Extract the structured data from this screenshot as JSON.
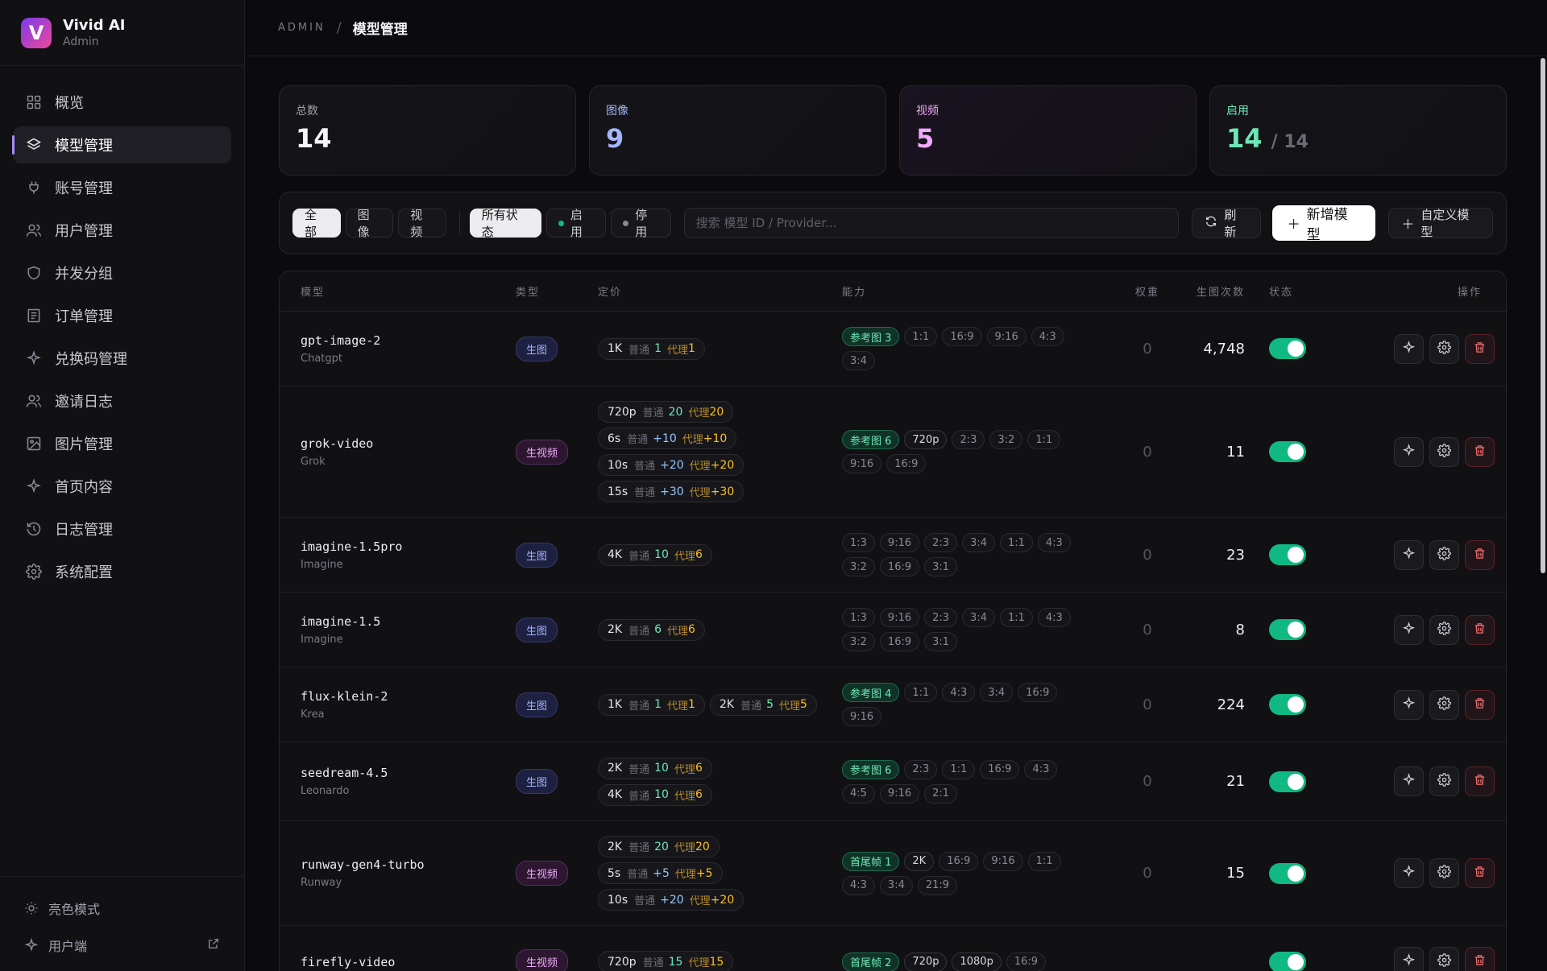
{
  "brand": {
    "name": "Vivid AI",
    "sub": "Admin",
    "logo_letter": "V"
  },
  "nav": [
    {
      "label": "概览",
      "icon": "grid-icon",
      "active": false
    },
    {
      "label": "模型管理",
      "icon": "layers-icon",
      "active": true
    },
    {
      "label": "账号管理",
      "icon": "plug-icon",
      "active": false
    },
    {
      "label": "用户管理",
      "icon": "users-icon",
      "active": false
    },
    {
      "label": "并发分组",
      "icon": "shield-icon",
      "active": false
    },
    {
      "label": "订单管理",
      "icon": "receipt-icon",
      "active": false
    },
    {
      "label": "兑换码管理",
      "icon": "sparkle-icon",
      "active": false
    },
    {
      "label": "邀请日志",
      "icon": "users-icon",
      "active": false
    },
    {
      "label": "图片管理",
      "icon": "image-icon",
      "active": false
    },
    {
      "label": "首页内容",
      "icon": "sparkle-icon",
      "active": false
    },
    {
      "label": "日志管理",
      "icon": "history-icon",
      "active": false
    },
    {
      "label": "系统配置",
      "icon": "gear-icon",
      "active": false
    }
  ],
  "footer": {
    "theme_label": "亮色模式",
    "client_label": "用户端"
  },
  "breadcrumb": {
    "root": "ADMIN",
    "sep": "/",
    "current": "模型管理"
  },
  "stats": {
    "total": {
      "label": "总数",
      "value": "14"
    },
    "image": {
      "label": "图像",
      "value": "9"
    },
    "video": {
      "label": "视频",
      "value": "5"
    },
    "enabled": {
      "label": "启用",
      "value": "14",
      "of": "/ 14"
    }
  },
  "filters": {
    "type": [
      "全部",
      "图像",
      "视频"
    ],
    "status": [
      "所有状态",
      "启用",
      "停用"
    ],
    "search_placeholder": "搜索 模型 ID / Provider...",
    "refresh_label": "刷新",
    "add_label": "新增模型",
    "custom_label": "自定义模型"
  },
  "table": {
    "headers": {
      "model": "模型",
      "type": "类型",
      "price": "定价",
      "cap": "能力",
      "weight": "权重",
      "count": "生图次数",
      "status": "状态",
      "ops": "操作"
    },
    "normal_label": "普通",
    "agent_label": "代理",
    "rows": [
      {
        "name": "gpt-image-2",
        "provider": "Chatgpt",
        "type": "生图",
        "kind": "img",
        "prices": [
          {
            "k": "1K",
            "n": "1",
            "a": "1"
          }
        ],
        "caps": [
          {
            "t": "参考图 3",
            "c": "ref"
          },
          {
            "t": "1:1"
          },
          {
            "t": "16:9"
          },
          {
            "t": "9:16"
          },
          {
            "t": "4:3"
          },
          {
            "t": "3:4"
          }
        ],
        "weight": "0",
        "count": "4,748",
        "enabled": true,
        "h": 93
      },
      {
        "name": "grok-video",
        "provider": "Grok",
        "type": "生视频",
        "kind": "vid",
        "prices": [
          {
            "k": "720p",
            "n": "20",
            "a": "20"
          },
          {
            "k": "6s",
            "n": "+10",
            "a": "+10",
            "plus": true
          },
          {
            "k": "10s",
            "n": "+20",
            "a": "+20",
            "plus": true
          },
          {
            "k": "15s",
            "n": "+30",
            "a": "+30",
            "plus": true
          }
        ],
        "caps": [
          {
            "t": "参考图 6",
            "c": "ref"
          },
          {
            "t": "720p",
            "c": "res"
          },
          {
            "t": "2:3"
          },
          {
            "t": "3:2"
          },
          {
            "t": "1:1"
          },
          {
            "t": "9:16"
          },
          {
            "t": "16:9"
          }
        ],
        "weight": "0",
        "count": "11",
        "enabled": true,
        "h": 163
      },
      {
        "name": "imagine-1.5pro",
        "provider": "Imagine",
        "type": "生图",
        "kind": "img",
        "prices": [
          {
            "k": "4K",
            "n": "10",
            "a": "6"
          }
        ],
        "caps": [
          {
            "t": "1:3"
          },
          {
            "t": "9:16"
          },
          {
            "t": "2:3"
          },
          {
            "t": "3:4"
          },
          {
            "t": "1:1"
          },
          {
            "t": "4:3"
          },
          {
            "t": "3:2"
          },
          {
            "t": "16:9"
          },
          {
            "t": "3:1"
          }
        ],
        "weight": "0",
        "count": "23",
        "enabled": true,
        "h": 93
      },
      {
        "name": "imagine-1.5",
        "provider": "Imagine",
        "type": "生图",
        "kind": "img",
        "prices": [
          {
            "k": "2K",
            "n": "6",
            "a": "6"
          }
        ],
        "caps": [
          {
            "t": "1:3"
          },
          {
            "t": "9:16"
          },
          {
            "t": "2:3"
          },
          {
            "t": "3:4"
          },
          {
            "t": "1:1"
          },
          {
            "t": "4:3"
          },
          {
            "t": "3:2"
          },
          {
            "t": "16:9"
          },
          {
            "t": "3:1"
          }
        ],
        "weight": "0",
        "count": "8",
        "enabled": true,
        "h": 93
      },
      {
        "name": "flux-klein-2",
        "provider": "Krea",
        "type": "生图",
        "kind": "img",
        "prices": [
          {
            "k": "1K",
            "n": "1",
            "a": "1"
          },
          {
            "k": "2K",
            "n": "5",
            "a": "5"
          }
        ],
        "caps": [
          {
            "t": "参考图 4",
            "c": "ref"
          },
          {
            "t": "1:1"
          },
          {
            "t": "4:3"
          },
          {
            "t": "3:4"
          },
          {
            "t": "16:9"
          },
          {
            "t": "9:16"
          }
        ],
        "weight": "0",
        "count": "224",
        "enabled": true,
        "h": 93
      },
      {
        "name": "seedream-4.5",
        "provider": "Leonardo",
        "type": "生图",
        "kind": "img",
        "prices": [
          {
            "k": "2K",
            "n": "10",
            "a": "6"
          },
          {
            "k": "4K",
            "n": "10",
            "a": "6"
          }
        ],
        "caps": [
          {
            "t": "参考图 6",
            "c": "ref"
          },
          {
            "t": "2:3"
          },
          {
            "t": "1:1"
          },
          {
            "t": "16:9"
          },
          {
            "t": "4:3"
          },
          {
            "t": "4:5"
          },
          {
            "t": "9:16"
          },
          {
            "t": "2:1"
          }
        ],
        "weight": "0",
        "count": "21",
        "enabled": true,
        "h": 98
      },
      {
        "name": "runway-gen4-turbo",
        "provider": "Runway",
        "type": "生视频",
        "kind": "vid",
        "prices": [
          {
            "k": "2K",
            "n": "20",
            "a": "20"
          },
          {
            "k": "5s",
            "n": "+5",
            "a": "+5",
            "plus": true
          },
          {
            "k": "10s",
            "n": "+20",
            "a": "+20",
            "plus": true
          }
        ],
        "caps": [
          {
            "t": "首尾帧 1",
            "c": "ref"
          },
          {
            "t": "2K",
            "c": "res"
          },
          {
            "t": "16:9"
          },
          {
            "t": "9:16"
          },
          {
            "t": "1:1"
          },
          {
            "t": "4:3"
          },
          {
            "t": "3:4"
          },
          {
            "t": "21:9"
          }
        ],
        "weight": "0",
        "count": "15",
        "enabled": true,
        "h": 130
      },
      {
        "name": "firefly-video",
        "provider": "",
        "type": "生视频",
        "kind": "vid",
        "prices": [
          {
            "k": "720p",
            "n": "15",
            "a": "15"
          }
        ],
        "caps": [
          {
            "t": "首尾帧 2",
            "c": "ref"
          },
          {
            "t": "720p",
            "c": "res"
          },
          {
            "t": "1080p",
            "c": "res"
          },
          {
            "t": "16:9"
          }
        ],
        "weight": "",
        "count": "",
        "enabled": true,
        "h": 90
      }
    ]
  }
}
